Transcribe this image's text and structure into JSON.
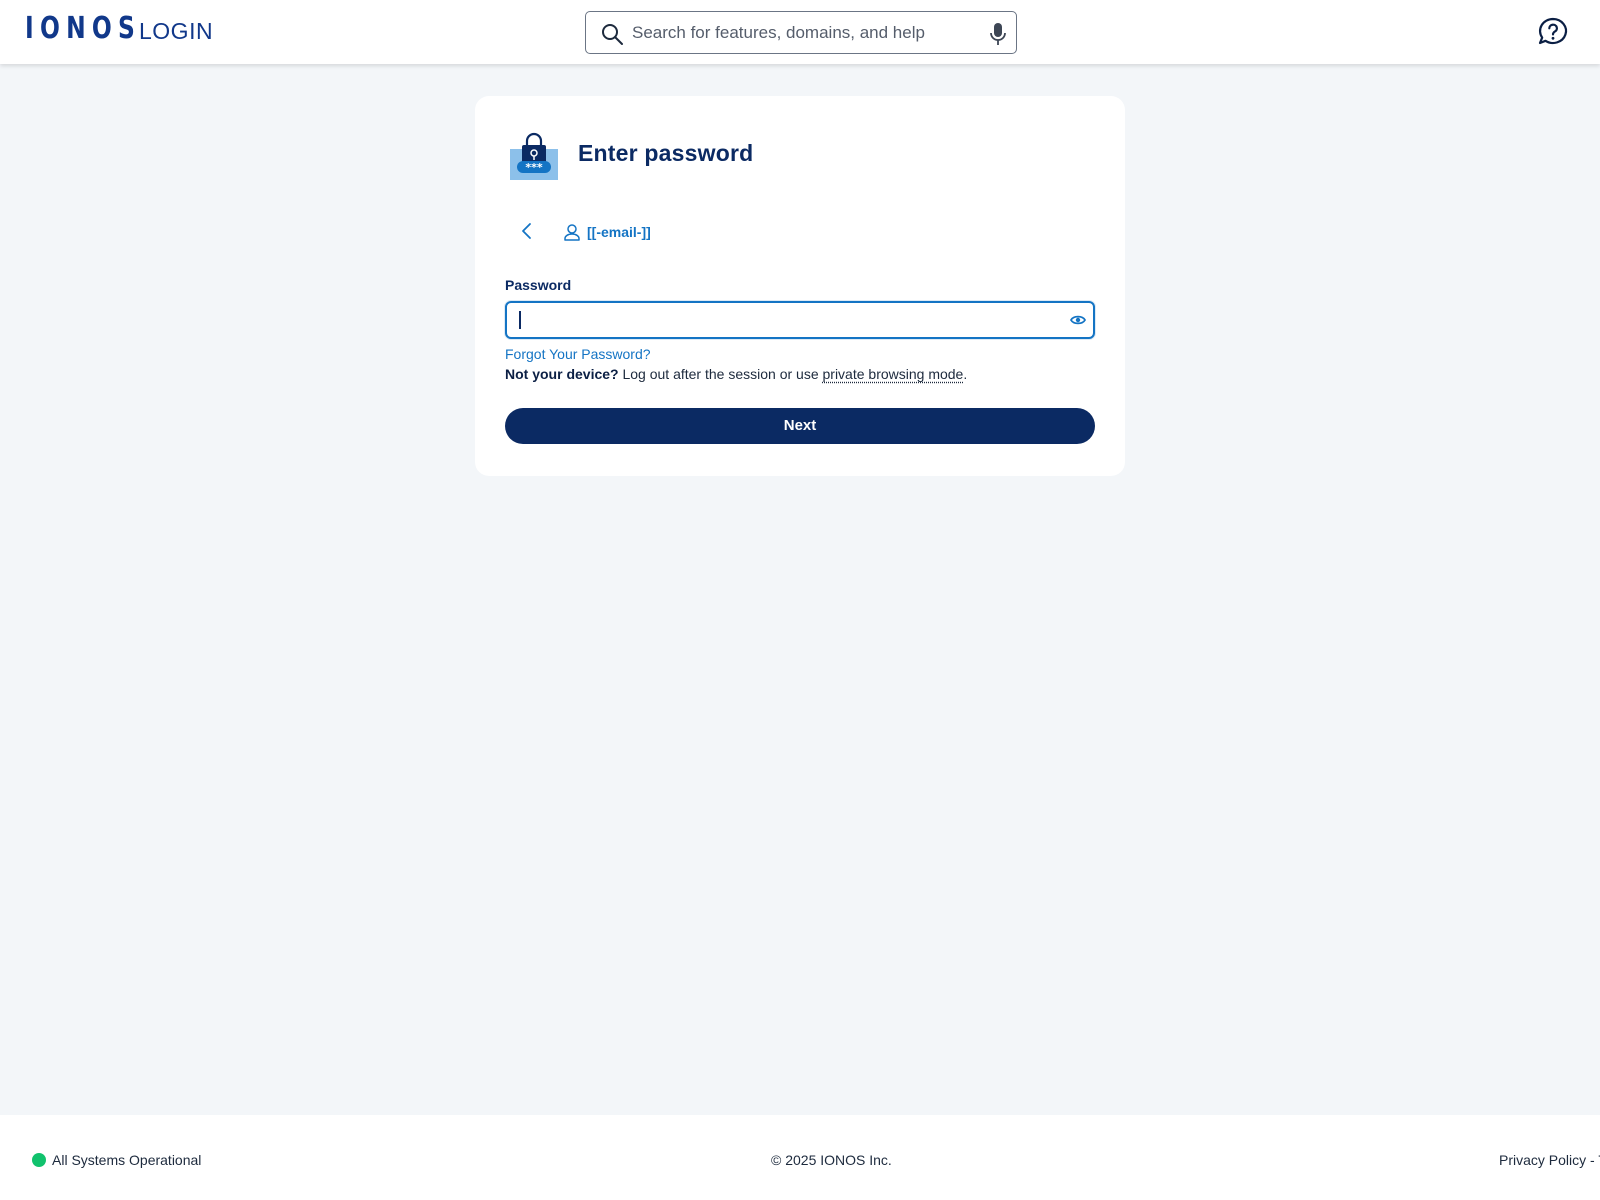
{
  "header": {
    "logo": "IONOS",
    "login_label": "LOGIN",
    "search_placeholder": "Search for features, domains, and help",
    "brand_color": "#11388a"
  },
  "card": {
    "title": "Enter password",
    "email": "[[-email-]]",
    "password_label": "Password",
    "password_value": "",
    "forgot_link": "Forgot Your Password?",
    "device_bold": "Not your device?",
    "device_text": " Log out after the session or use ",
    "private_link": "private browsing mode",
    "device_end": ".",
    "next_button": "Next",
    "accent_color": "#1474c4",
    "button_color": "#0b2a63"
  },
  "icons": {
    "search": "search-icon",
    "mic": "microphone-icon",
    "help": "help-chat-icon",
    "lock": "password-lock-icon",
    "back": "chevron-left-icon",
    "user": "user-icon",
    "eye": "eye-icon"
  },
  "footer": {
    "status": "All Systems Operational",
    "status_color": "#11c26d",
    "copyright": "© 2025 IONOS Inc.",
    "privacy": "Privacy Policy - T"
  }
}
